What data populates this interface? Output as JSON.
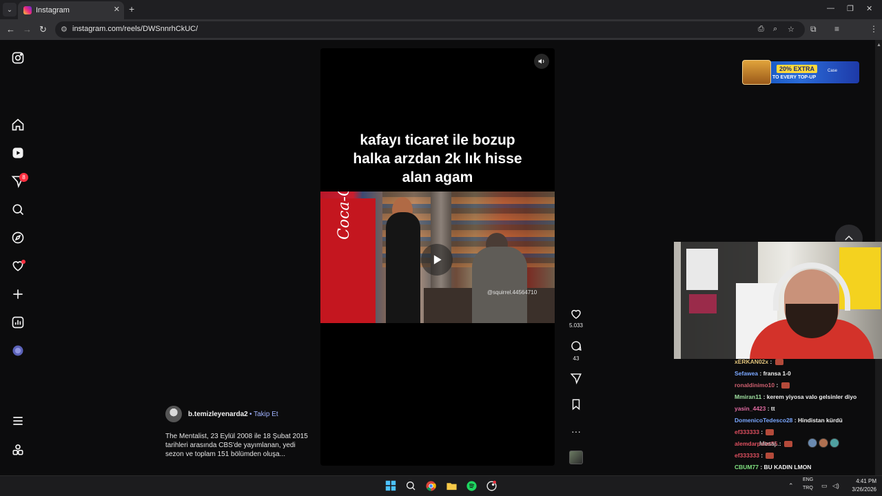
{
  "browser": {
    "tab_title": "Instagram",
    "url": "instagram.com/reels/DWSnnrhCkUC/",
    "icons": [
      "tab-list-icon",
      "close-tab-icon",
      "new-tab-icon",
      "minimize-icon",
      "restore-icon",
      "close-window-icon",
      "back-icon",
      "forward-icon",
      "reload-icon",
      "site-info-icon",
      "install-icon",
      "zoom-icon",
      "bookmark-star-icon",
      "extensions-icon",
      "media-icon",
      "profile-icon",
      "menu-icon"
    ]
  },
  "sidebar": {
    "notifications_badge": "8",
    "items": [
      "instagram-logo",
      "home",
      "reels",
      "messages",
      "search",
      "explore",
      "notifications",
      "create",
      "dashboard",
      "profile",
      "more",
      "also-from-meta"
    ]
  },
  "reel": {
    "overlay_caption": "kafayı ticaret ile bozup\nhalka arzdan 2k lık hisse\nalan agam",
    "video_brand_text": "Coca-Cola",
    "watermark": "@squirrel.44564710",
    "likes": "5.033",
    "comments": "43",
    "author": "b.temizleyenarda2",
    "follow_separator": "•",
    "follow_label": "Takip Et",
    "description": "The Mentalist, 23 Eylül 2008 ile 18 Şubat 2015 tarihleri arasında CBS'de yayımlanan, yedi sezon ve toplam 151 bölümden oluşa..."
  },
  "ad": {
    "line1": "20% EXTRA",
    "line2": "TO EVERY TOP-UP",
    "brand": "Case"
  },
  "chat": {
    "messages": [
      {
        "user": "xERKAN02x",
        "text": "",
        "color": "#e0c27a",
        "emote": true
      },
      {
        "user": "Sefawea",
        "text": "fransa 1-0",
        "color": "#7aa7ff",
        "emote": false
      },
      {
        "user": "ronaldinimo10",
        "text": "",
        "color": "#d06070",
        "emote": true
      },
      {
        "user": "Mmiran11",
        "text": "kerem yiyosa valo gelsinler diyo",
        "color": "#9fe0a0",
        "emote": false
      },
      {
        "user": "yasin_4423",
        "text": "tt",
        "color": "#e06aa0",
        "emote": false
      },
      {
        "user": "DomenicoTedesco28",
        "text": "Hindistan kürdü",
        "color": "#7aa7ff",
        "emote": false
      },
      {
        "user": "ef333333",
        "text": "",
        "color": "#e05060",
        "emote": true
      },
      {
        "user": "alemdarpolat55",
        "text": "",
        "color": "#e05060",
        "emote": true
      },
      {
        "user": "ef333333",
        "text": "",
        "color": "#e05060",
        "emote": true
      },
      {
        "user": "CBUM77",
        "text": "BU KADIN LMON",
        "color": "#7fe07f",
        "emote": false
      },
      {
        "user": "ef333333",
        "text": "",
        "color": "#e05060",
        "emote": true
      }
    ],
    "input_placeholder": "Mesaj..."
  },
  "taskbar": {
    "lang1": "ENG",
    "lang2": "TRQ",
    "time": "4:41 PM",
    "date": "3/26/2026",
    "apps": [
      "windows-start",
      "search",
      "chrome",
      "file-explorer",
      "spotify",
      "steam"
    ]
  }
}
